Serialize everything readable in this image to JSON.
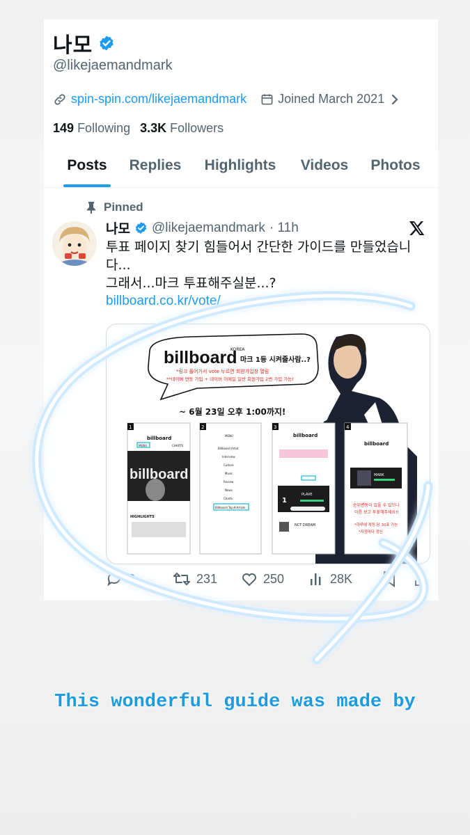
{
  "profile": {
    "display_name": "나모",
    "handle": "@likejaemandmark",
    "link": "spin-spin.com/likejaemandmark",
    "joined": "Joined March 2021",
    "following_count": "149",
    "following_label": "Following",
    "followers_count": "3.3K",
    "followers_label": "Followers"
  },
  "tabs": [
    "Posts",
    "Replies",
    "Highlights",
    "Videos",
    "Photos"
  ],
  "post": {
    "pinned_label": "Pinned",
    "author_name": "나모",
    "author_handle": "@likejaemandmark",
    "time": "· 11h",
    "text_line1": "투표 페이지 찾기 힘들어서 간단한 가이드를 만들었습니",
    "text_line2": "다...",
    "text_line3": "그래서...마크 투표해주실분...?",
    "link_text": "billboard.co.kr/vote/",
    "media": {
      "logo": "billboard",
      "logo_sub": "KOREA",
      "headline": "마크 1등 시켜줄사람..?",
      "note1": "*링크 들어가서 vote 누르면 회원가입창 열림",
      "note2": "**네이버 연동 가입 + 네이버 이메일 일반 회원가입 2번 가입 가능!",
      "deadline": "~ 6월 23일 오후 1:00까지!",
      "steps": [
        "1",
        "2",
        "3",
        "4"
      ],
      "s1_menu": "MENU",
      "s1_charts": "CHARTS",
      "s1_highlights": "HIGHLIGHTS",
      "s2_menu_items": [
        "Billboard Artist",
        "Interview",
        "Culture",
        "Music",
        "Review",
        "News",
        "Charts",
        "Billboard Top-K-Artists"
      ],
      "s3_artist1": "PLAVE",
      "s3_artist2": "NCT DREAM",
      "s4_artist": "MARK",
      "s4_note1": "순위변동이 있을 수 있으니",
      "s4_note2": "이름 보고 투표해주세요!!",
      "s4_note3": "*하루에 계정 당 30표 가능",
      "s4_note4": "*자정마다 갱신"
    },
    "replies": "2",
    "reposts": "231",
    "likes": "250",
    "views": "28K"
  },
  "caption": "This wonderful guide was made by",
  "colors": {
    "accent": "#1d9bf0",
    "text": "#0f1419",
    "muted": "#536471",
    "caption": "#1e9be0"
  }
}
